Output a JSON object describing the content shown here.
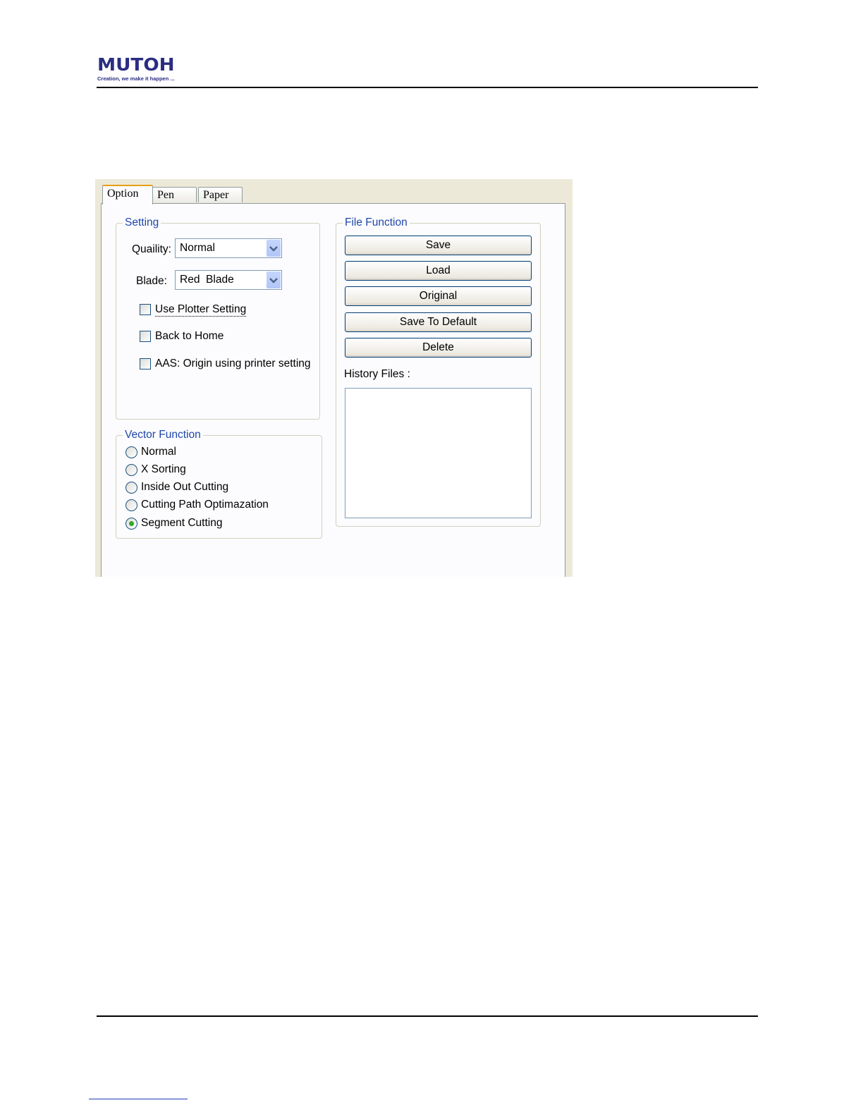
{
  "header": {
    "logo_word": "MUTOH",
    "logo_tagline": "Creation, we make it happen ..."
  },
  "dialog": {
    "tabs": [
      "Option",
      "Pen",
      "Paper"
    ],
    "setting": {
      "title": "Setting",
      "quality_label": "Quaility:",
      "quality_value": "Normal",
      "blade_label": "Blade:",
      "blade_value": "Red  Blade",
      "checkboxes": [
        {
          "label": "Use Plotter Setting",
          "checked": false
        },
        {
          "label": "Back to Home",
          "checked": false
        },
        {
          "label": "AAS: Origin using printer setting",
          "checked": false
        }
      ]
    },
    "vector_function": {
      "title": "Vector Function",
      "options": [
        {
          "label": "Normal",
          "selected": false
        },
        {
          "label": "X Sorting",
          "selected": false
        },
        {
          "label": "Inside Out Cutting",
          "selected": false
        },
        {
          "label": "Cutting Path Optimazation",
          "selected": false
        },
        {
          "label": "Segment Cutting",
          "selected": true
        }
      ]
    },
    "file_function": {
      "title": "File Function",
      "buttons": [
        "Save",
        "Load",
        "Original",
        "Save To Default",
        "Delete"
      ],
      "history_label": "History Files :"
    }
  },
  "colors": {
    "brand": "#2b2d83",
    "group_title": "#1e47a8",
    "radio_selected": "#2fa82a",
    "tab_highlight": "#e69f14"
  }
}
